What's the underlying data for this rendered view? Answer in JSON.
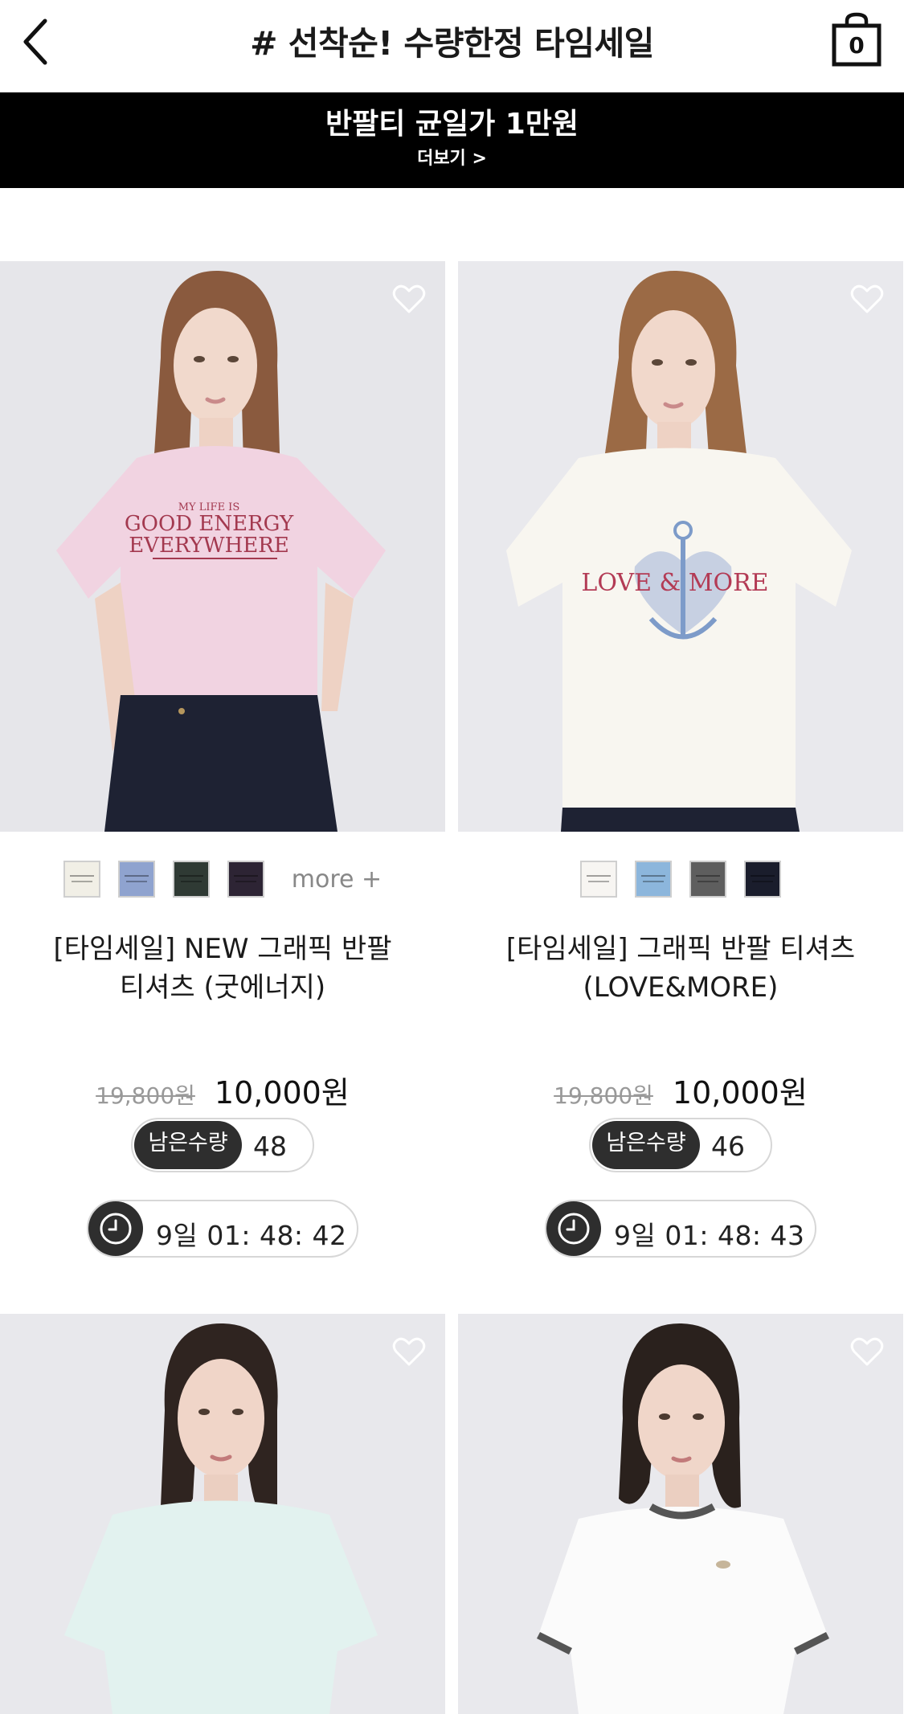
{
  "header": {
    "title": "# 선착순! 수량한정 타임세일",
    "cart_count": "0"
  },
  "banner": {
    "title": "반팔티 균일가 1만원",
    "more_label": "더보기 >"
  },
  "products": [
    {
      "name_line1": "[타임세일] NEW 그래픽 반팔",
      "name_line2": "티셔츠 (굿에너지)",
      "original_price": "19,800원",
      "sale_price": "10,000원",
      "stock_label": "남은수량",
      "stock": "48",
      "timer": "9일 01: 48: 42",
      "more_label": "more +",
      "swatches": [
        "#f1efe6",
        "#8fa3cf",
        "#2f3a34",
        "#2d2434"
      ],
      "shirt_color": "#f1d3e1",
      "print_text1": "GOOD ENERGY",
      "print_text2": "EVERYWHERE"
    },
    {
      "name_line1": "[타임세일] 그래픽 반팔 티셔츠",
      "name_line2": "(LOVE&MORE)",
      "original_price": "19,800원",
      "sale_price": "10,000원",
      "stock_label": "남은수량",
      "stock": "46",
      "timer": "9일 01: 48: 43",
      "swatches": [
        "#f7f5f2",
        "#8cb6dc",
        "#5e5e5e",
        "#1a1d2c"
      ],
      "shirt_color": "#f8f6f0",
      "print_text1": "LOVE & MORE"
    },
    {
      "shirt_color": "#e2f2ef"
    },
    {
      "shirt_color": "#fbfbfb"
    }
  ]
}
